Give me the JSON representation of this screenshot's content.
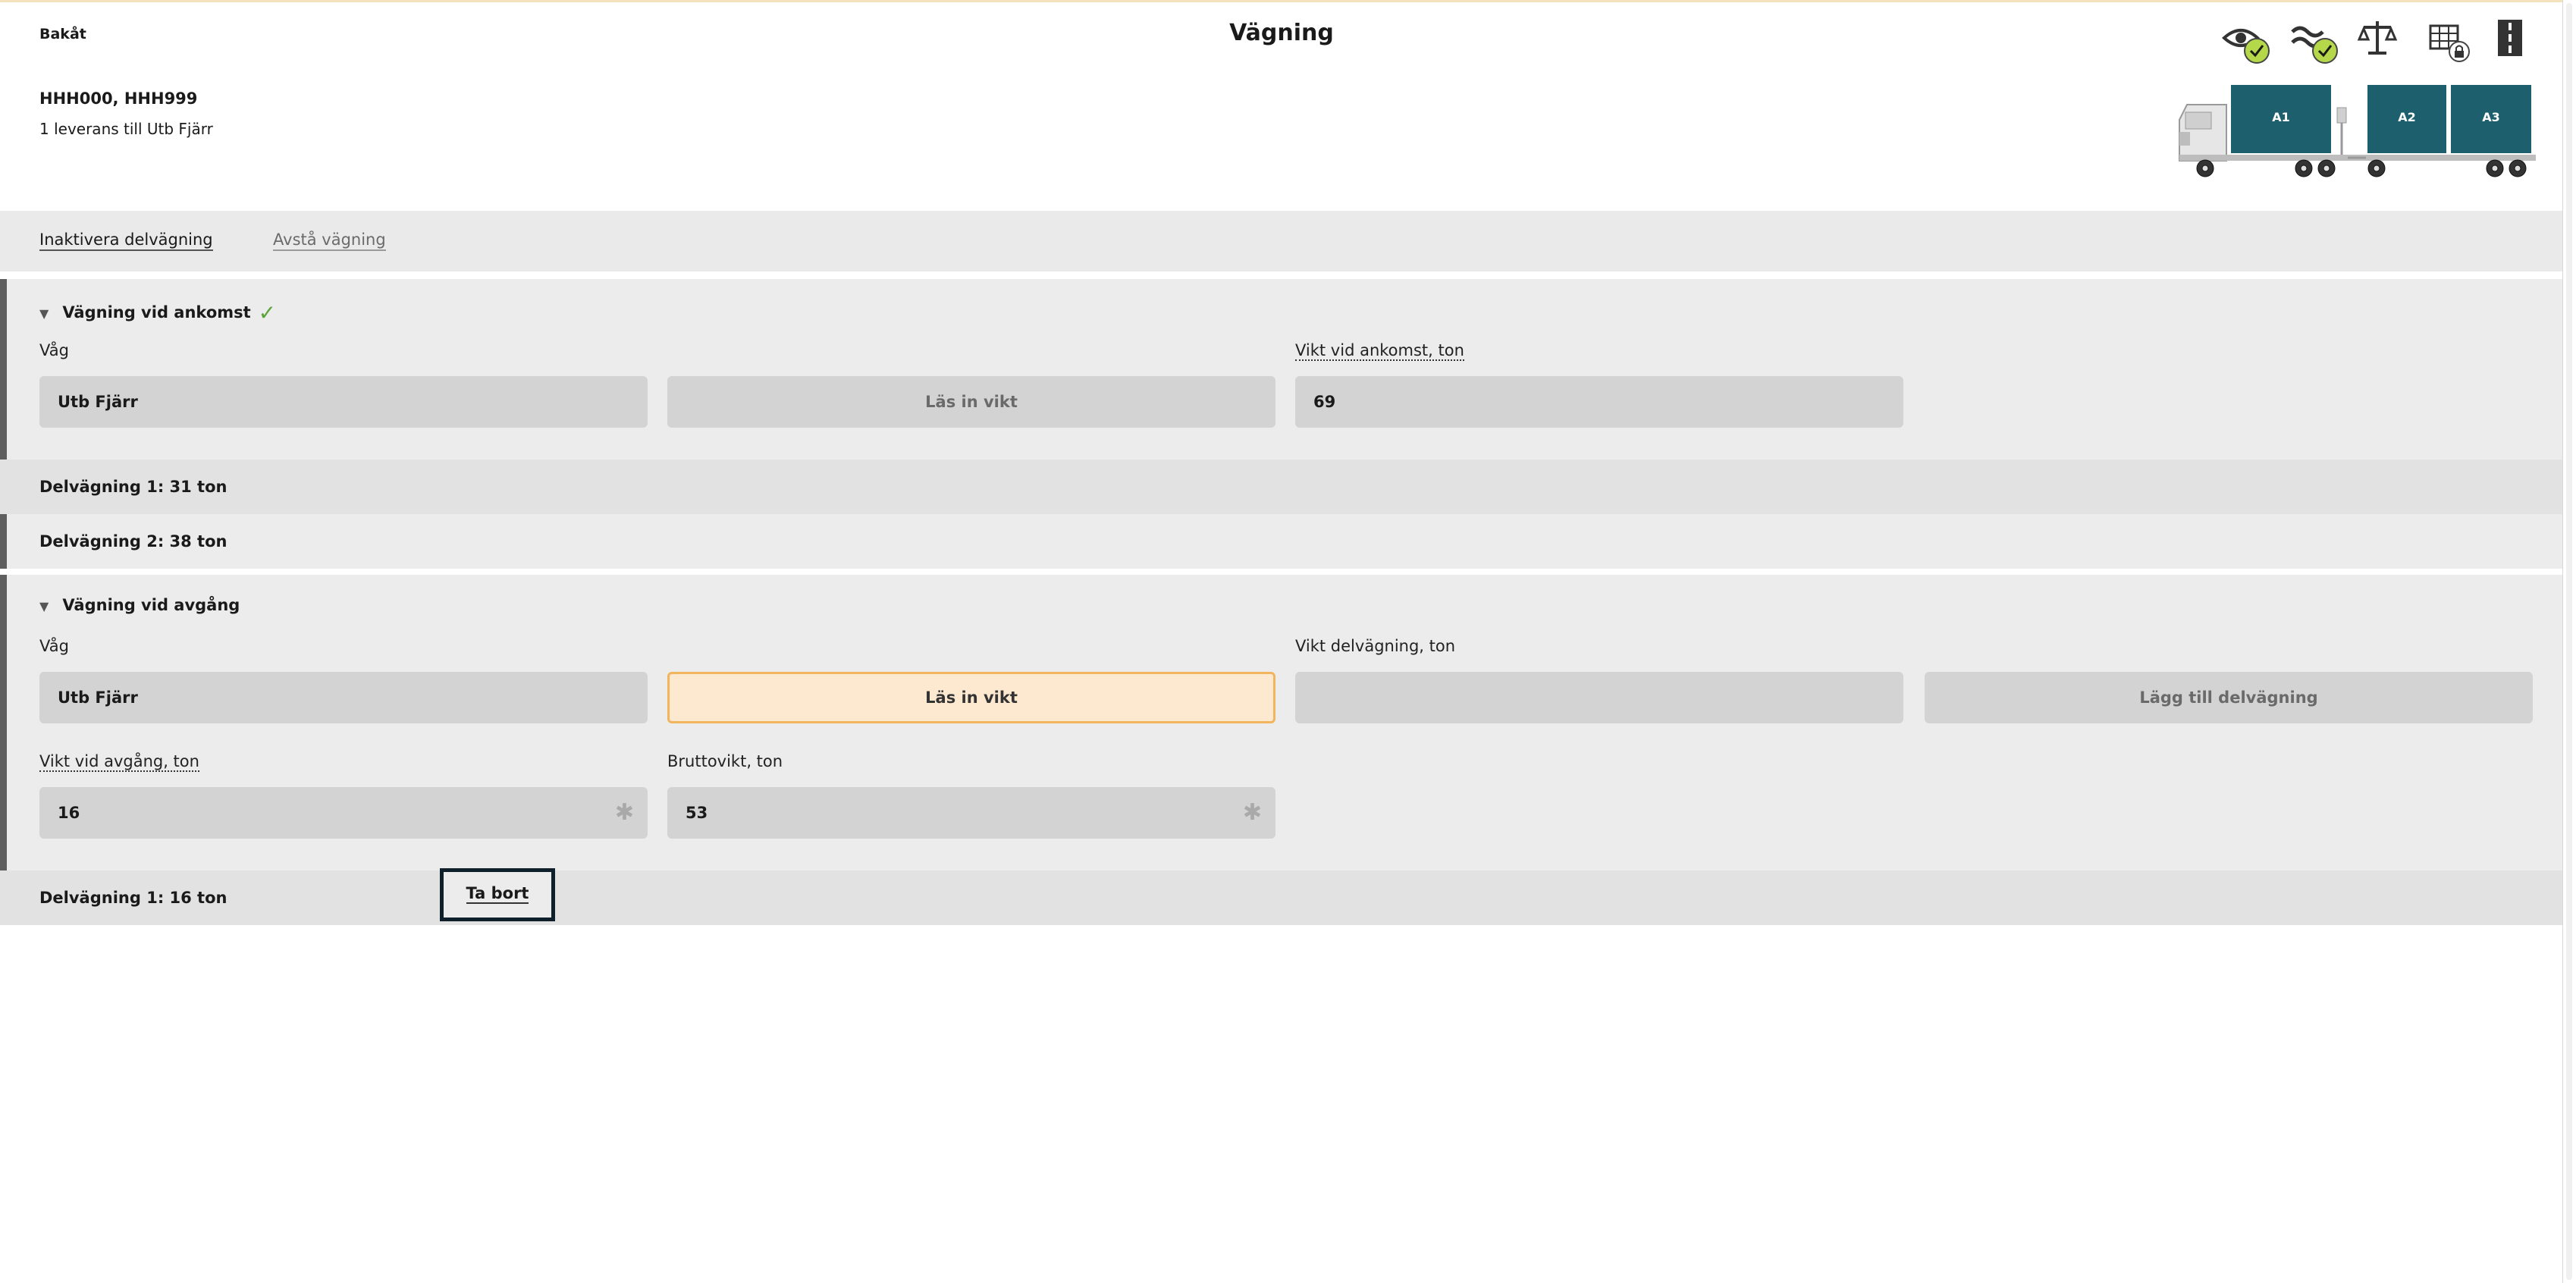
{
  "header": {
    "back_label": "Bakåt",
    "title": "Vägning",
    "plates": "HHH000, HHH999",
    "delivery_info": "1 leverans till Utb Fjärr"
  },
  "status_icons": [
    "eye-checked-icon",
    "wave-checked-icon",
    "scale-icon",
    "grid-locked-icon",
    "road-icon"
  ],
  "vehicle": {
    "compartments": [
      "A1",
      "A2",
      "A3"
    ],
    "color": "#1d5f6d"
  },
  "actions": {
    "deactivate_label": "Inaktivera delvägning",
    "skip_label": "Avstå vägning"
  },
  "arrival": {
    "header": "Vägning vid ankomst",
    "scale_label": "Våg",
    "scale_value": "Utb Fjärr",
    "read_button": "Läs in vikt",
    "weight_label": "Vikt vid ankomst, ton",
    "weight_value": "69",
    "partials": [
      "Delvägning 1: 31 ton",
      "Delvägning 2: 38 ton"
    ]
  },
  "departure": {
    "header": "Vägning vid avgång",
    "scale_label": "Våg",
    "scale_value": "Utb Fjärr",
    "read_button": "Läs in vikt",
    "partial_label": "Vikt delvägning, ton",
    "partial_value": "",
    "add_partial_button": "Lägg till delvägning",
    "dep_weight_label": "Vikt vid avgång, ton",
    "dep_weight_value": "16",
    "gross_label": "Bruttovikt, ton",
    "gross_value": "53",
    "partials": [
      "Delvägning 1: 16 ton"
    ],
    "remove_label": "Ta bort"
  },
  "colors": {
    "accent_border": "#f2b45c",
    "accent_fill": "#fde8d0",
    "check_green": "#5aa53b"
  }
}
